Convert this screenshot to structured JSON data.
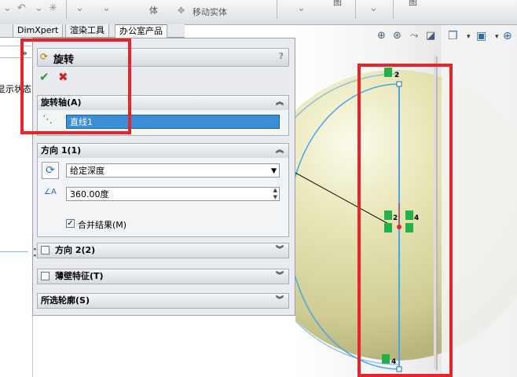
{
  "ribbon": {
    "item1": "体",
    "item2": "移动实体",
    "item3": "图",
    "item4": "图"
  },
  "tabs": [
    {
      "label": "DimXpert"
    },
    {
      "label": "渲染工具"
    },
    {
      "label": "办公室产品"
    }
  ],
  "tree": {
    "state_text": "显示状态",
    "arrow": "»"
  },
  "pm": {
    "title": "旋转",
    "help": "?",
    "ok_symbol": "✔",
    "cancel_symbol": "✖",
    "axis_section": {
      "title": "旋转轴(A)",
      "value": "直线1"
    },
    "dir1_section": {
      "title": "方向 1(1)",
      "type_value": "给定深度",
      "angle_value": "360.00度",
      "merge_label": "合并结果(M)",
      "merge_checked": true
    },
    "dir2_section": {
      "title": "方向 2(2)"
    },
    "thin_section": {
      "title": "薄壁特征(T)"
    },
    "profile_section": {
      "title": "所选轮廓(S)"
    }
  },
  "sketch": {
    "point_labels": [
      "2",
      "2",
      "4",
      "4"
    ]
  },
  "colors": {
    "accent": "#3a8fd6",
    "annotation": "#e8232a",
    "sphere": "#e6e4b5",
    "sketch_line": "#4aa3e8",
    "constraint": "#25b04a"
  }
}
